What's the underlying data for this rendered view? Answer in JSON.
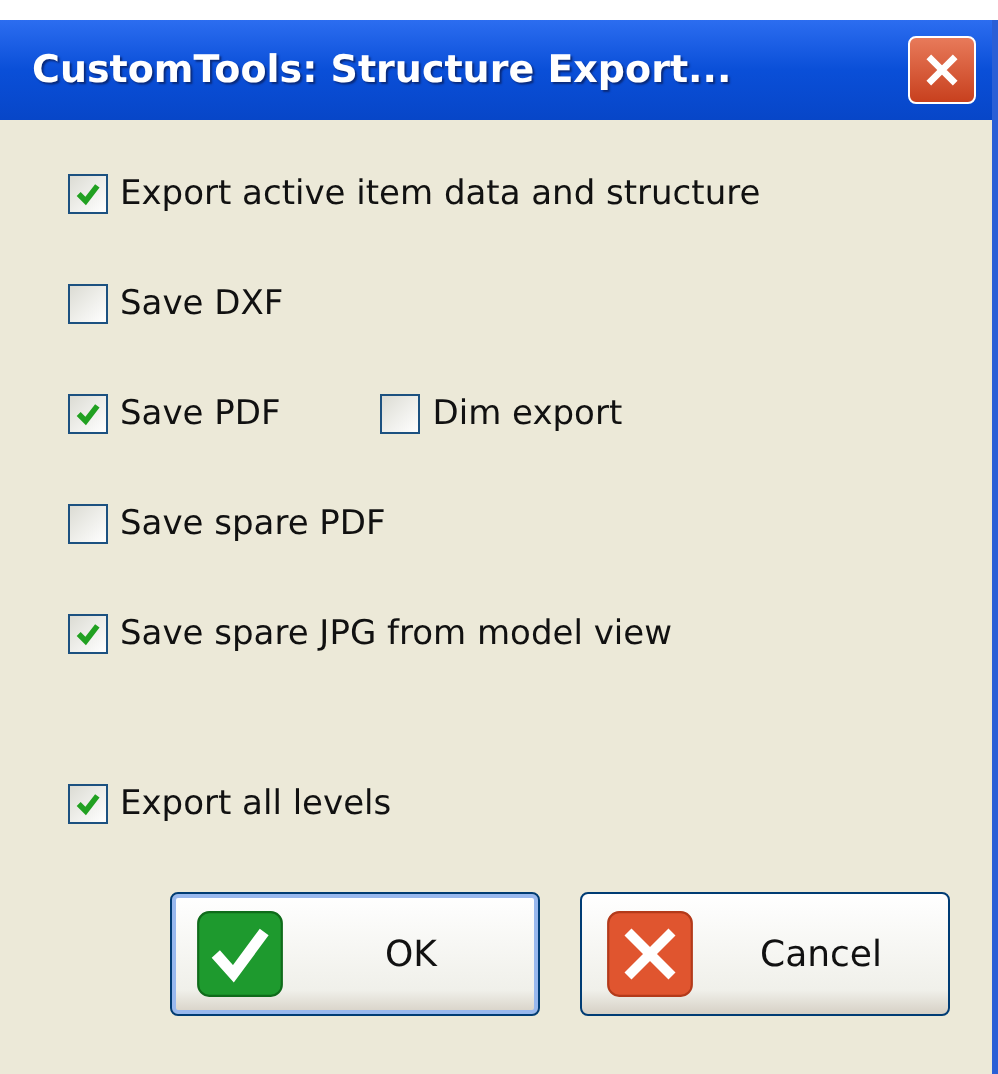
{
  "window": {
    "title": "CustomTools: Structure Export..."
  },
  "options": [
    [
      {
        "label": "Export active item data and structure",
        "checked": true
      }
    ],
    [
      {
        "label": "Save DXF",
        "checked": false
      }
    ],
    [
      {
        "label": "Save PDF",
        "checked": true
      },
      {
        "label": "Dim export",
        "checked": false
      }
    ],
    [
      {
        "label": "Save spare PDF",
        "checked": false
      }
    ],
    [
      {
        "label": "Save spare JPG from model view",
        "checked": true
      }
    ]
  ],
  "levels_option": {
    "label": "Export all levels",
    "checked": true
  },
  "buttons": [
    {
      "label": "OK",
      "kind": "ok",
      "selected": true
    },
    {
      "label": "Cancel",
      "kind": "cancel",
      "selected": false
    }
  ]
}
